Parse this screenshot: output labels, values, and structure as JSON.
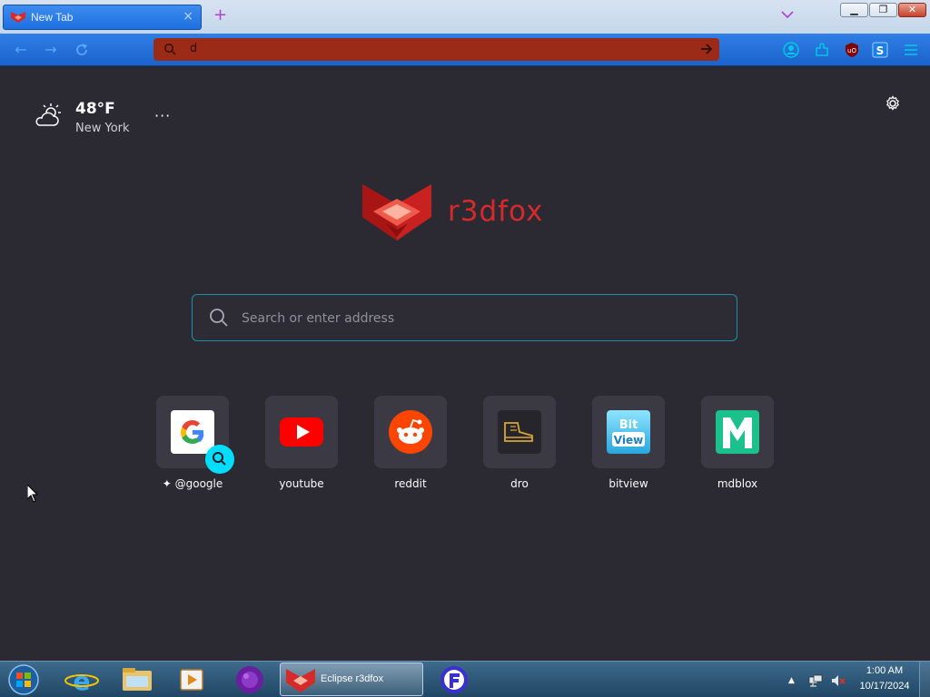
{
  "browser": {
    "tab": {
      "title": "New Tab"
    },
    "new_tab_symbol": "+",
    "url": {
      "value": "d"
    }
  },
  "weather": {
    "temperature": "48°F",
    "city": "New York",
    "menu": "···"
  },
  "logo": {
    "wordmark": "r3dfox"
  },
  "search": {
    "placeholder": "Search or enter address"
  },
  "shortcuts": [
    {
      "label": "@google",
      "icon": "google-icon"
    },
    {
      "label": "youtube",
      "icon": "youtube-icon"
    },
    {
      "label": "reddit",
      "icon": "reddit-icon"
    },
    {
      "label": "dro",
      "icon": "boot-icon"
    },
    {
      "label": "bitview",
      "icon": "bitview-icon"
    },
    {
      "label": "mdblox",
      "icon": "mdblox-icon"
    }
  ],
  "taskbar": {
    "active_window": "Eclipse r3dfox",
    "time": "1:00 AM",
    "date": "10/17/2024"
  },
  "colors": {
    "page_bg": "#2b2a33",
    "accent": "#00ddff",
    "brand_red": "#d62a2a",
    "urlbar": "#9b2a17"
  }
}
